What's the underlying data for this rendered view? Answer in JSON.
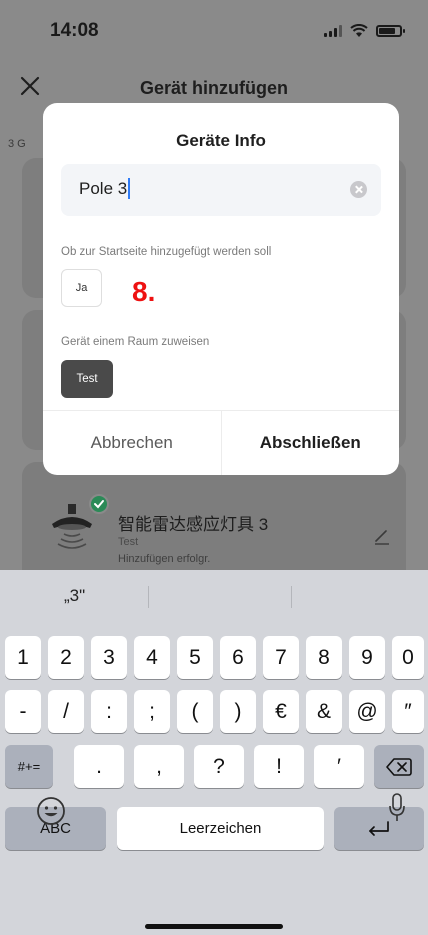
{
  "status_bar": {
    "time": "14:08"
  },
  "navbar": {
    "title": "Gerät hinzufügen",
    "close_icon": "close-icon"
  },
  "background": {
    "count_label_partial": "3 G",
    "device": {
      "name": "智能雷达感应灯具 3",
      "room": "Test",
      "status": "Hinzufügen erfolgr."
    }
  },
  "dialog": {
    "title": "Geräte Info",
    "name_field": {
      "value": "Pole 3"
    },
    "home_prompt": "Ob zur Startseite hinzugefügt werden soll",
    "home_option": "Ja",
    "room_prompt": "Gerät einem Raum zuweisen",
    "room_option": "Test",
    "cancel_label": "Abbrechen",
    "finish_label": "Abschließen"
  },
  "annotation": {
    "step_label": "8."
  },
  "keyboard": {
    "suggestion": "„3\"",
    "row1": [
      "1",
      "2",
      "3",
      "4",
      "5",
      "6",
      "7",
      "8",
      "9",
      "0"
    ],
    "row2": [
      "-",
      "/",
      ":",
      ";",
      "(",
      ")",
      "€",
      "&",
      "@",
      "″"
    ],
    "row3_toggle": "#+=",
    "row3": [
      ".",
      ",",
      "?",
      "!",
      "′"
    ],
    "abc_label": "ABC",
    "space_label": "Leerzeichen"
  }
}
